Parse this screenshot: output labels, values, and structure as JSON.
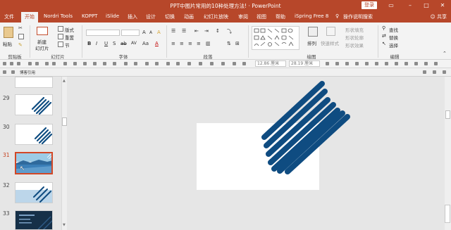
{
  "window": {
    "title": "PPT中图片常用的10种处理方法! · PowerPoint",
    "login": "登录",
    "controls": [
      "▭",
      "–",
      "□",
      "✕"
    ]
  },
  "tabs": [
    "文件",
    "开始",
    "Nordri Tools",
    "KOPPT",
    "iSlide",
    "插入",
    "设计",
    "切换",
    "动画",
    "幻灯片放映",
    "审阅",
    "视图",
    "帮助",
    "iSpring Free 8",
    "操作说明搜索"
  ],
  "active_tab": "开始",
  "share": "共享",
  "ribbon": {
    "clipboard": {
      "paste": "粘贴",
      "label": "剪贴板"
    },
    "slides": {
      "new_slide_1": "新建",
      "new_slide_2": "幻灯片",
      "layout": "版式",
      "reset": "重置",
      "section": "节",
      "label": "幻灯片"
    },
    "font": {
      "label": "字体",
      "format_buttons": [
        "B",
        "I",
        "U",
        "S",
        "ab",
        "AV",
        "Aa",
        "A"
      ]
    },
    "paragraph": {
      "label": "段落"
    },
    "drawing": {
      "arrange": "排列",
      "quick_styles": "快速样式",
      "fill": "形状填充",
      "outline": "形状轮廓",
      "effects": "形状效果",
      "label": "绘图"
    },
    "editing": {
      "find": "查找",
      "replace": "替换",
      "select": "选择",
      "label": "编辑"
    }
  },
  "qat": {
    "size_w": "12.86 厘米",
    "size_h": "28.19 厘米",
    "zoom": "博客引用"
  },
  "slides": [
    {
      "number": "29"
    },
    {
      "number": "30"
    },
    {
      "number": "31",
      "selected": true
    },
    {
      "number": "32"
    },
    {
      "number": "33"
    }
  ],
  "colors": {
    "accent": "#b7472a",
    "stripe": "#0f4c81",
    "selected_border": "#d24726"
  }
}
